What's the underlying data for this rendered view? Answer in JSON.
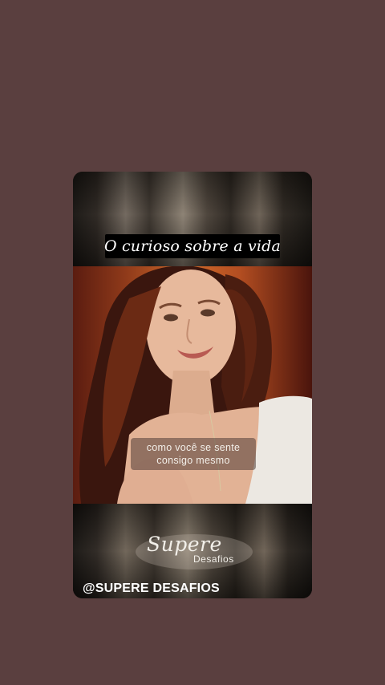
{
  "story": {
    "title": "O curioso sobre a vida",
    "subtitle_lines": [
      "como você se sente",
      "consigo mesmo"
    ],
    "logo": {
      "script": "Supere",
      "sub": "Desafios"
    },
    "handle": "@SUPERE DESAFIOS"
  },
  "colors": {
    "background": "#5a3f3f",
    "title_box": "#000000"
  }
}
